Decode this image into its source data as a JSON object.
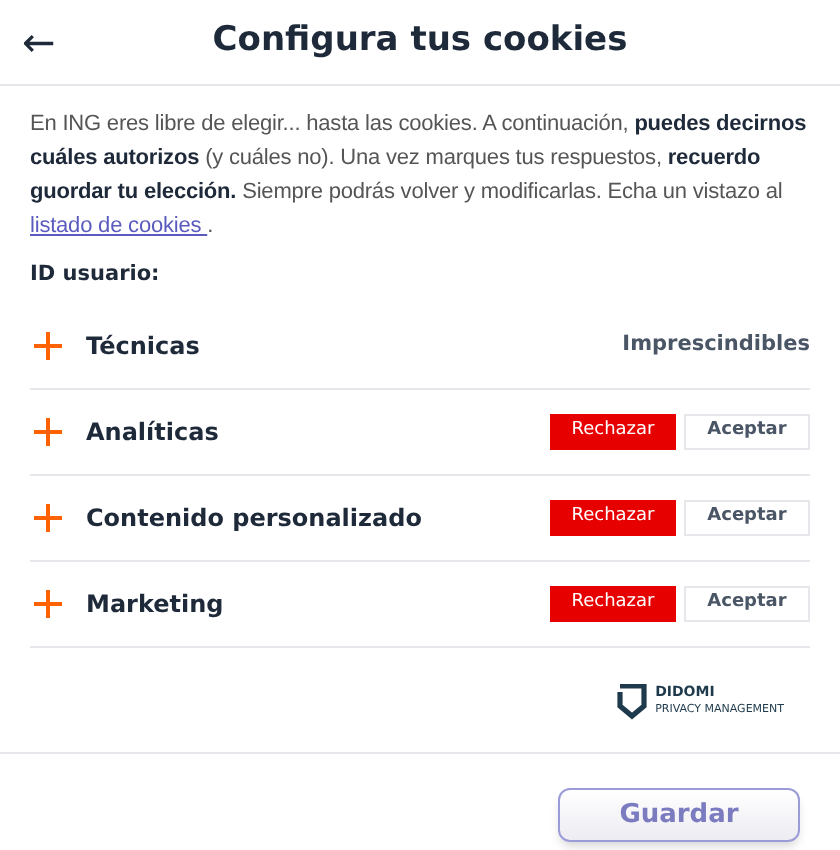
{
  "header": {
    "back_icon": "←",
    "title": "Configura tus cookies"
  },
  "intro": {
    "text": "En ING eres libre de elegir... hasta las cookies. A continuación, **puedes decirnos cuáles autorizos** (y cuáles no). Una vez marques tus respuestos, **recuerdo guordar tu elección.** Siempre podrás volver y modificarlas. Echa un vistazo al ",
    "link": "listado de cookies ",
    "end": "."
  },
  "user_id_label": "ID usuario:",
  "categories": [
    {
      "kind": "fixed",
      "name": "Técnicas",
      "status": "Imprescindibles"
    },
    {
      "kind": "choice",
      "name": "Analíticas",
      "buttons": [
        {
          "label": "Rechazar",
          "selected": true
        },
        {
          "label": "Aceptar",
          "selected": false
        }
      ]
    },
    {
      "kind": "choice",
      "name": "Contenido personalizado",
      "buttons": [
        {
          "label": "Rechazar",
          "selected": true
        },
        {
          "label": "Aceptar",
          "selected": false
        }
      ]
    },
    {
      "kind": "choice",
      "name": "Marketing",
      "buttons": [
        {
          "label": "Rechazar",
          "selected": true
        },
        {
          "label": "Aceptar",
          "selected": false
        }
      ]
    }
  ],
  "branding": {
    "name": "DIDOMI",
    "tagline": "PRIVACY MANAGEMENT"
  },
  "save_button": "Guardar"
}
